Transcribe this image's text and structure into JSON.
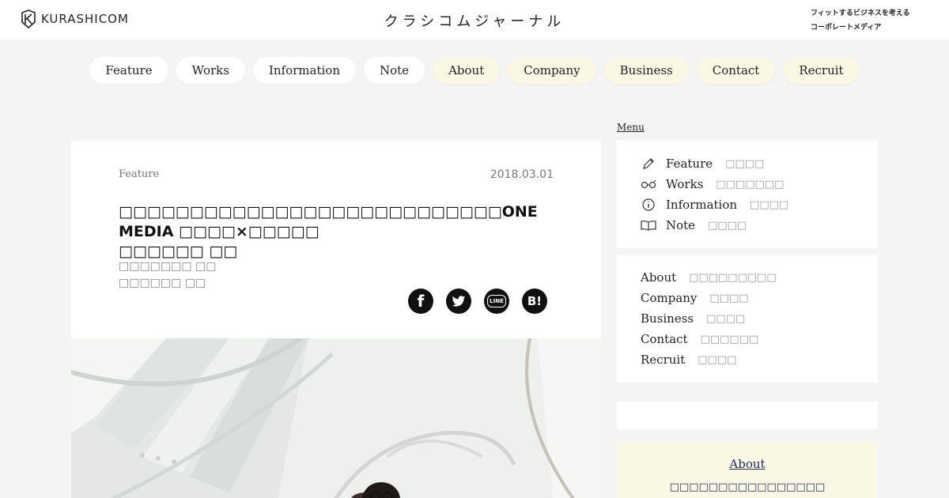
{
  "header": {
    "logo_text": "KURASHICOM",
    "site_title": "クラシコムジャーナル",
    "tagline_line1": "フィットするビジネスを考える",
    "tagline_line2": "コーポレートメディア"
  },
  "nav": [
    {
      "label": "Feature",
      "style": "white"
    },
    {
      "label": "Works",
      "style": "white"
    },
    {
      "label": "Information",
      "style": "white"
    },
    {
      "label": "Note",
      "style": "white"
    },
    {
      "label": "About",
      "style": "cream"
    },
    {
      "label": "Company",
      "style": "cream"
    },
    {
      "label": "Business",
      "style": "cream"
    },
    {
      "label": "Contact",
      "style": "cream"
    },
    {
      "label": "Recruit",
      "style": "cream"
    }
  ],
  "article": {
    "category": "Feature",
    "date": "2018.03.01",
    "title_line1": "□□□□□□□□□□□□□□□□□□□□□□□□□□□ONE MEDIA □□□□×□□□□□",
    "title_line2": "□□□□□□ □□",
    "author_line1": "□□□□□□□ □□",
    "author_line2": "□□□□□□ □□",
    "share": [
      {
        "name": "facebook",
        "glyph": "f"
      },
      {
        "name": "twitter",
        "glyph": ""
      },
      {
        "name": "line",
        "glyph": "LINE"
      },
      {
        "name": "hatena-bookmark",
        "glyph": "B!"
      }
    ]
  },
  "sidebar": {
    "menu_label": "Menu",
    "primary": [
      {
        "en": "Feature",
        "jp": "□□□□",
        "icon": "pen-icon"
      },
      {
        "en": "Works",
        "jp": "□□□□□□□",
        "icon": "glasses-icon"
      },
      {
        "en": "Information",
        "jp": "□□□□",
        "icon": "info-icon"
      },
      {
        "en": "Note",
        "jp": "□□□□",
        "icon": "book-icon"
      }
    ],
    "secondary": [
      {
        "en": "About",
        "jp": "□□□□□□□□□"
      },
      {
        "en": "Company",
        "jp": "□□□□"
      },
      {
        "en": "Business",
        "jp": "□□□□"
      },
      {
        "en": "Contact",
        "jp": "□□□□□□"
      },
      {
        "en": "Recruit",
        "jp": "□□□□"
      }
    ],
    "about": {
      "title": "About",
      "desc": "□□□□□□□□□□□□□□□□"
    }
  },
  "colors": {
    "background": "#f4f4f4",
    "pill_cream": "#faf7e4",
    "about_navy": "#1f2a5e"
  }
}
